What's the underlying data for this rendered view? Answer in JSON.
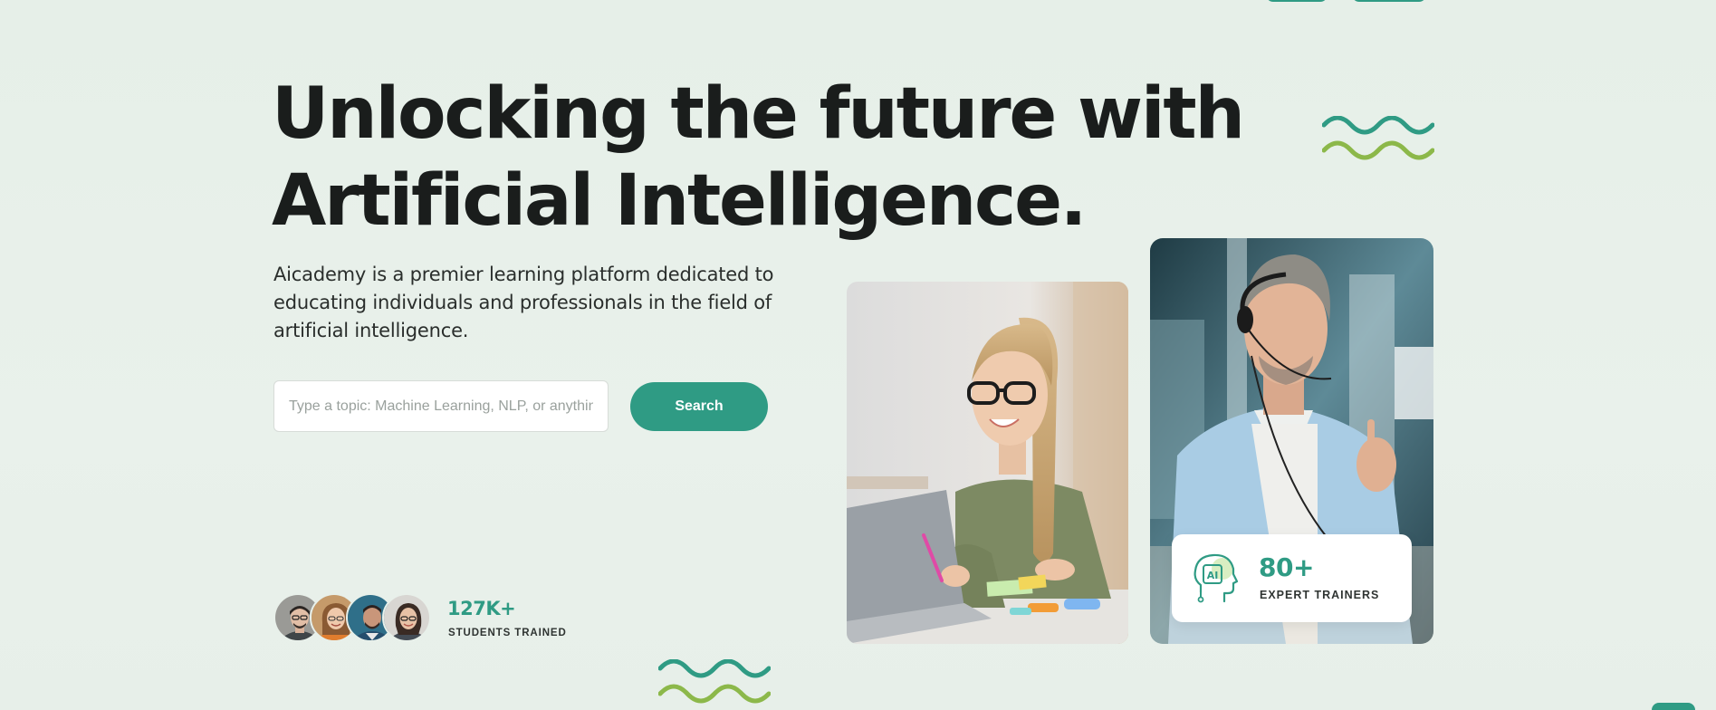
{
  "hero": {
    "title_line1": "Unlocking the future with",
    "title_line2": "Artificial Intelligence.",
    "description": "Aicademy is a premier learning platform dedicated to educating individuals and professionals in the field of artificial intelligence."
  },
  "search": {
    "placeholder": "Type a topic: Machine Learning, NLP, or anything AI!",
    "value": "",
    "button_label": "Search"
  },
  "students": {
    "count": "127K+",
    "label": "STUDENTS TRAINED"
  },
  "trainers": {
    "count": "80+",
    "label": "EXPERT TRAINERS",
    "icon": "ai-head-icon"
  },
  "colors": {
    "accent": "#2f9b84",
    "accent_light": "#8cb84a",
    "background": "#e8f0ea",
    "text": "#1a1d1c"
  }
}
